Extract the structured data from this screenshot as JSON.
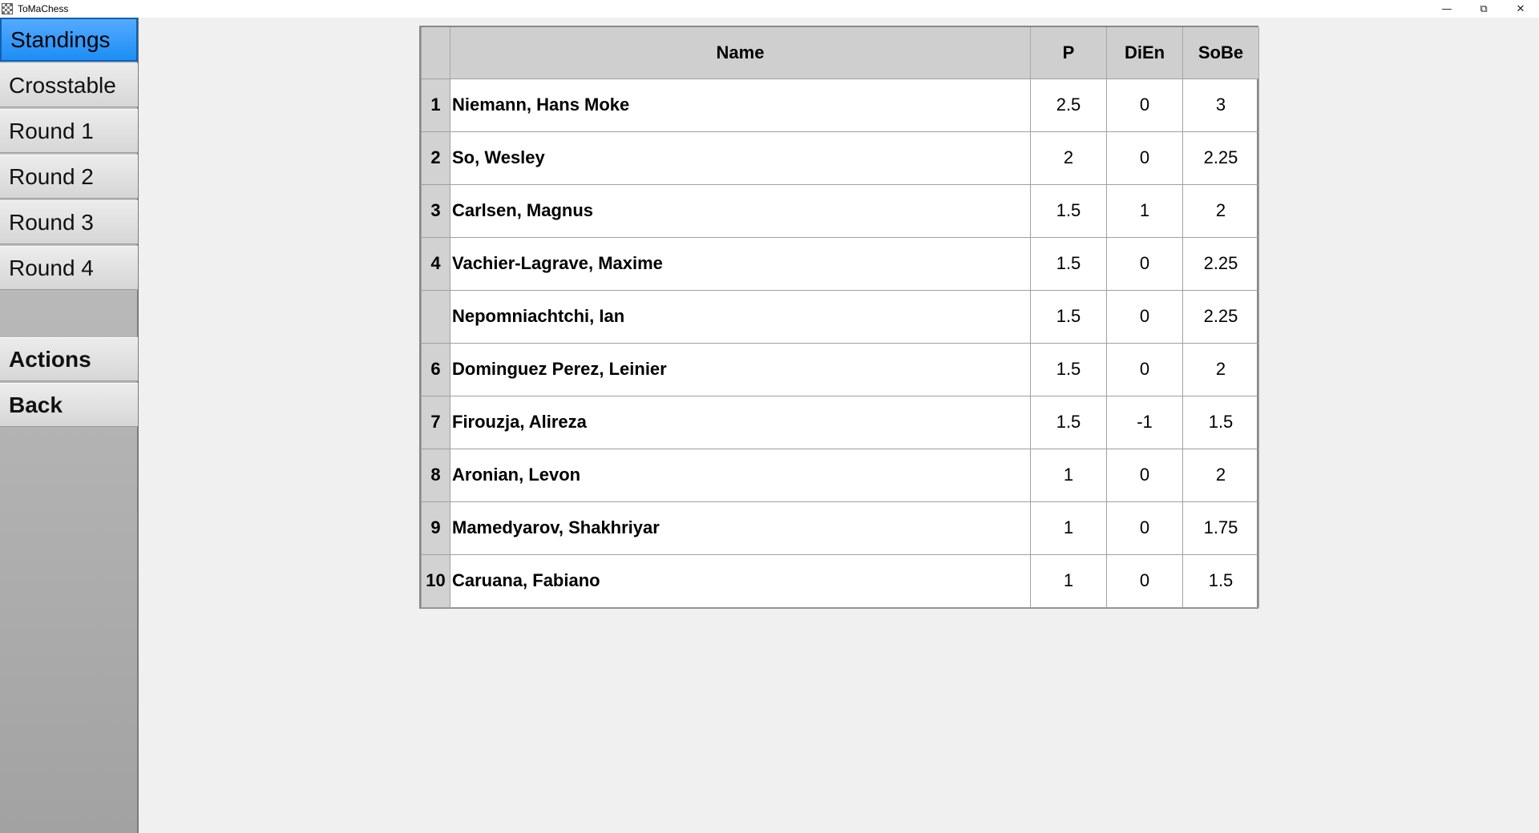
{
  "window": {
    "title": "ToMaChess",
    "minimize": "—",
    "restore": "⧉",
    "close": "✕"
  },
  "sidebar": {
    "items": [
      {
        "label": "Standings"
      },
      {
        "label": "Crosstable"
      },
      {
        "label": "Round 1"
      },
      {
        "label": "Round 2"
      },
      {
        "label": "Round 3"
      },
      {
        "label": "Round 4"
      }
    ],
    "actions_label": "Actions",
    "back_label": "Back"
  },
  "standings": {
    "columns": {
      "rank": "",
      "name": "Name",
      "points": "P",
      "dien": "DiEn",
      "sobe": "SoBe"
    },
    "rows": [
      {
        "rank": "1",
        "name": "Niemann, Hans Moke",
        "p": "2.5",
        "dien": "0",
        "sobe": "3"
      },
      {
        "rank": "2",
        "name": "So, Wesley",
        "p": "2",
        "dien": "0",
        "sobe": "2.25"
      },
      {
        "rank": "3",
        "name": "Carlsen, Magnus",
        "p": "1.5",
        "dien": "1",
        "sobe": "2"
      },
      {
        "rank": "4",
        "name": "Vachier-Lagrave, Maxime",
        "p": "1.5",
        "dien": "0",
        "sobe": "2.25"
      },
      {
        "rank": "",
        "name": "Nepomniachtchi, Ian",
        "p": "1.5",
        "dien": "0",
        "sobe": "2.25"
      },
      {
        "rank": "6",
        "name": "Dominguez Perez, Leinier",
        "p": "1.5",
        "dien": "0",
        "sobe": "2"
      },
      {
        "rank": "7",
        "name": "Firouzja, Alireza",
        "p": "1.5",
        "dien": "-1",
        "sobe": "1.5"
      },
      {
        "rank": "8",
        "name": "Aronian, Levon",
        "p": "1",
        "dien": "0",
        "sobe": "2"
      },
      {
        "rank": "9",
        "name": "Mamedyarov, Shakhriyar",
        "p": "1",
        "dien": "0",
        "sobe": "1.75"
      },
      {
        "rank": "10",
        "name": "Caruana, Fabiano",
        "p": "1",
        "dien": "0",
        "sobe": "1.5"
      }
    ]
  },
  "colors": {
    "active_nav": "#1c8ef5",
    "header_bg": "#cfcfcf",
    "background": "#f0f0f0"
  }
}
